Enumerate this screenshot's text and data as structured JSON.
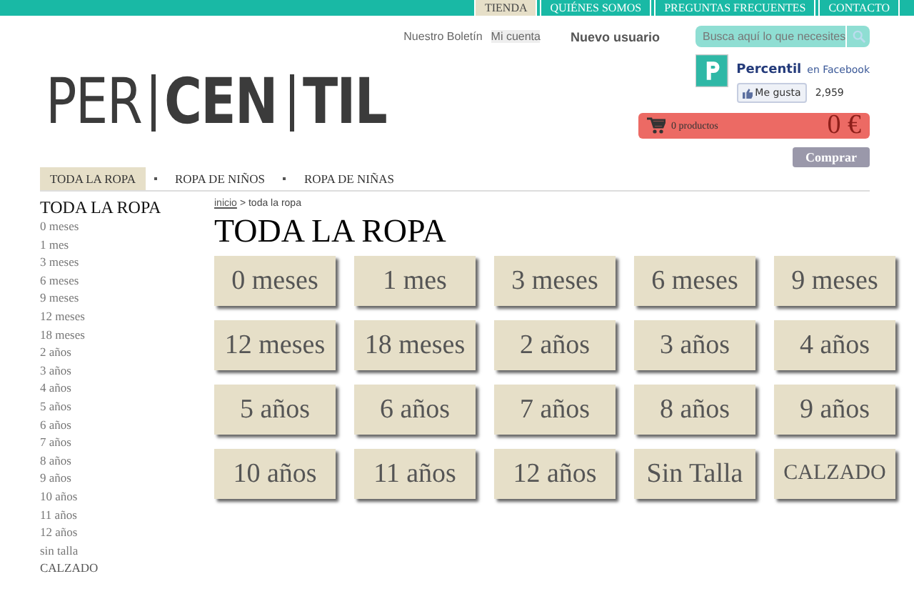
{
  "top_tabs": [
    {
      "label": "TIENDA",
      "selected": true
    },
    {
      "label": "QUIÉNES SOMOS",
      "selected": false
    },
    {
      "label": "PREGUNTAS FRECUENTES",
      "selected": false
    },
    {
      "label": "CONTACTO",
      "selected": false
    }
  ],
  "header_links": {
    "newsletter": "Nuestro Boletín",
    "account": "Mi cuenta",
    "new_user": "Nuevo usuario"
  },
  "search": {
    "placeholder": "Busca aquí lo que necesites"
  },
  "logo": [
    "PER",
    "CEN",
    "TIL"
  ],
  "facebook": {
    "page": "Percentil",
    "suffix": "en Facebook",
    "like_button": "Me gusta",
    "count": "2,959"
  },
  "cart": {
    "items": "0 productos",
    "total": "0 €"
  },
  "buy_button": "Comprar",
  "nav": [
    {
      "label": "TODA LA ROPA",
      "selected": true
    },
    {
      "label": "ROPA DE NIÑOS",
      "selected": false
    },
    {
      "label": "ROPA DE NIÑAS",
      "selected": false
    }
  ],
  "sidebar": {
    "title": "TODA LA ROPA",
    "items": [
      "0 meses",
      "1 mes",
      "3 meses",
      "6 meses",
      "9 meses",
      "12 meses",
      "18 meses",
      "2 años",
      "3 años",
      "4 años",
      "5 años",
      "6 años",
      "7 años",
      "8 años",
      "9 años",
      "10 años",
      "11 años",
      "12 años",
      "sin talla",
      "CALZADO"
    ]
  },
  "breadcrumb": {
    "link": "inicio",
    "rest": "> toda la ropa"
  },
  "page_title": "TODA LA ROPA",
  "categories": [
    "0 meses",
    "1 mes",
    "3 meses",
    "6 meses",
    "9 meses",
    "12 meses",
    "18 meses",
    "2 años",
    "3 años",
    "4 años",
    "5 años",
    "6 años",
    "7 años",
    "8 años",
    "9 años",
    "10 años",
    "11 años",
    "12 años",
    "Sin Talla",
    "CALZADO"
  ]
}
